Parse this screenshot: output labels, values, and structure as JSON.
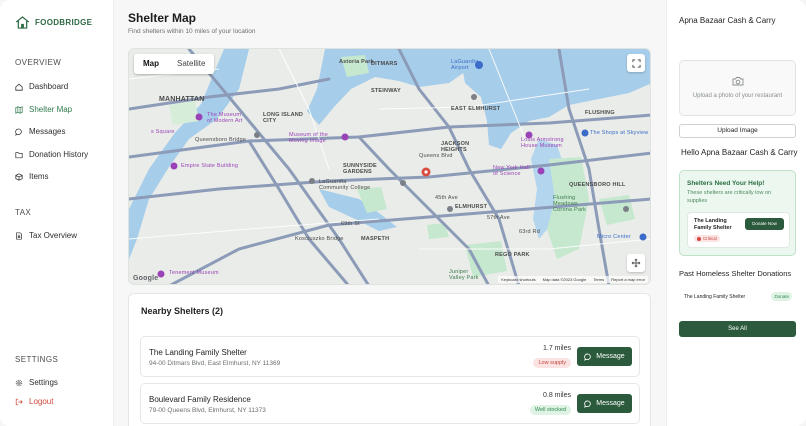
{
  "brand": {
    "name": "FOODBRIDGE"
  },
  "sidebar": {
    "overview_title": "OVERVIEW",
    "items": [
      {
        "label": "Dashboard",
        "icon": "home-icon"
      },
      {
        "label": "Shelter Map",
        "icon": "map-icon"
      },
      {
        "label": "Messages",
        "icon": "chat-icon"
      },
      {
        "label": "Donation History",
        "icon": "folder-icon"
      },
      {
        "label": "Items",
        "icon": "box-icon"
      }
    ],
    "tax_title": "TAX",
    "tax_items": [
      {
        "label": "Tax Overview",
        "icon": "document-icon"
      }
    ],
    "settings_title": "SETTINGS",
    "settings_items": [
      {
        "label": "Settings",
        "icon": "gear-icon"
      },
      {
        "label": "Logout",
        "icon": "logout-icon"
      }
    ],
    "active": "Shelter Map",
    "accent": "#2f7a4a",
    "logout_color": "#d0463a"
  },
  "main": {
    "title": "Shelter Map",
    "subtitle": "Find shelters within 10 miles of your location",
    "map": {
      "tabs": [
        "Map",
        "Satellite"
      ],
      "active_tab": "Map",
      "labels": {
        "astoria_park": "Astoria Park",
        "ditmars": "DITMARS",
        "steinway": "STEINWAY",
        "laguardia": "LaGuardia\nAirport",
        "manhattan": "MANHATTAN",
        "moma": "The Museum\nof Modern Art",
        "queensboro": "Queensboro Bridge",
        "long_island_city": "LONG ISLAND\nCITY",
        "museum_moving_image": "Museum of the\nMoving Image",
        "east_elmhurst": "EAST ELMHURST",
        "jackson_heights": "JACKSON\nHEIGHTS",
        "louis_armstrong": "Louis Armstrong\nHouse Museum",
        "flushing": "FLUSHING",
        "shops_skyview": "The Shops at Skyview",
        "empire_state": "Empire State Building",
        "sunnyside": "SUNNYSIDE\nGARDENS",
        "laguardia_cc": "LaGuardia\nCommunity College",
        "ny_hall_science": "New York Hall\nof Science",
        "queensboro_hill": "QUEENSBORO HILL",
        "elmhurst": "ELMHURST",
        "flushing_meadows": "Flushing\nMeadows\nCorona Park",
        "kosciuszko": "Kosciuszko Bridge",
        "maspeth": "MASPETH",
        "micro_center": "Micro Center",
        "rego_park": "REGO PARK",
        "tenement": "Tenement Museum",
        "juniper": "Juniper\nValley Park",
        "square": "s Square",
        "queens_blvd": "Queens Blvd",
        "ave_45th": "45th Ave",
        "ave_57th": "57th Ave",
        "ave_63rd": "63rd Rd",
        "ave_69th": "69th St"
      },
      "footer": [
        "Keyboard shortcuts",
        "Map data ©2023 Google",
        "Terms",
        "Report a map error"
      ],
      "google": "Google"
    },
    "shelters": {
      "title": "Nearby Shelters (2)",
      "list": [
        {
          "name": "The Landing Family Shelter",
          "address": "94-00 Ditmars Blvd, East Elmhurst, NY 11369",
          "distance": "1.7 miles",
          "status": "Low supply",
          "action": "Message"
        },
        {
          "name": "Boulevard Family Residence",
          "address": "79-00 Queens Blvd, Elmhurst, NY 11373",
          "distance": "0.8 miles",
          "status": "Well stocked",
          "action": "Message"
        }
      ]
    }
  },
  "right": {
    "store_name": "Apna Bazaar Cash & Carry",
    "upload_placeholder": "Upload a photo of your restaurant",
    "upload_button": "Upload Image",
    "greeting": "Hello Apna Bazaar Cash & Carry",
    "need_title": "Shelters Need Your Help!",
    "need_subtitle": "These shelters are critically low on supplies",
    "need_card": {
      "name": "The Landing Family Shelter",
      "status": "Critical",
      "action": "Donate Now"
    },
    "past_title": "Past Homeless Shelter Donations",
    "past_list": [
      {
        "name": "The Landing Family Shelter",
        "action": "Donate"
      }
    ],
    "see_all": "See All"
  }
}
